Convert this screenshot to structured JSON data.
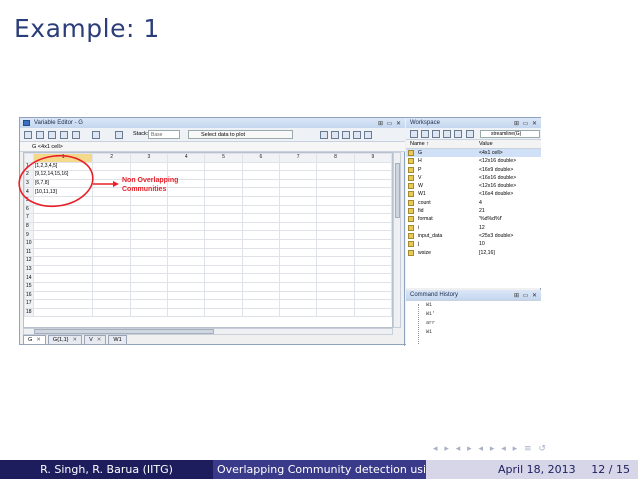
{
  "slide": {
    "title": "Example: 1"
  },
  "variable_editor": {
    "title": "Variable Editor - G",
    "window_buttons": "⊞ ▭ ✕",
    "toolbar": {
      "stack_label": "Stack:",
      "stack_value": "Base",
      "select_plot": "Select data to plot"
    },
    "address": "G <4x1 cell>",
    "col_headers": [
      "1",
      "2",
      "3",
      "4",
      "5",
      "6",
      "7",
      "8",
      "9"
    ],
    "row_numbers": [
      "1",
      "2",
      "3",
      "4",
      "5",
      "6",
      "7",
      "8",
      "9",
      "10",
      "11",
      "12",
      "13",
      "14",
      "15",
      "16",
      "17",
      "18"
    ],
    "cells": [
      "[1,2,3,4,5]",
      "[9,12,14,15,16]",
      "[6,7,8]",
      "[10,11,13]"
    ],
    "tabs": [
      {
        "label": "G",
        "close": "✕"
      },
      {
        "label": "G{1,1}",
        "close": "✕"
      },
      {
        "label": "V",
        "close": "✕"
      },
      {
        "label": "W1",
        "close": ""
      }
    ]
  },
  "annotation": {
    "line1": "Non Overlapping",
    "line2": "Communities"
  },
  "workspace": {
    "title": "Workspace",
    "combo": "streamline(G)",
    "header_name": "Name ↑",
    "header_value": "Value",
    "rows": [
      {
        "name": "G",
        "value": "<4x1 cell>"
      },
      {
        "name": "H",
        "value": "<12x16 double>"
      },
      {
        "name": "P",
        "value": "<16x9 double>"
      },
      {
        "name": "V",
        "value": "<16x16 double>"
      },
      {
        "name": "W",
        "value": "<12x16 double>"
      },
      {
        "name": "W1",
        "value": "<16x4 double>"
      },
      {
        "name": "count",
        "value": "4"
      },
      {
        "name": "fid",
        "value": "21"
      },
      {
        "name": "format",
        "value": "'%d%d%f'"
      },
      {
        "name": "i",
        "value": "12"
      },
      {
        "name": "input_data",
        "value": "<25x3 double>"
      },
      {
        "name": "j",
        "value": "10"
      },
      {
        "name": "wsize",
        "value": "[12,16]"
      }
    ]
  },
  "command_history": {
    "title": "Command History",
    "items": [
      "W1",
      "W1'",
      "arr",
      "W1"
    ]
  },
  "footer": {
    "authors": "R. Singh, R. Barua (IITG)",
    "talk_title": "Overlapping Community detection using Baye",
    "date": "April 18, 2013",
    "page": "12 / 15"
  },
  "colors": {
    "title_blue": "#2c3e7a",
    "footer_dark": "#1d1d5e",
    "annotation_red": "#e8202a"
  }
}
